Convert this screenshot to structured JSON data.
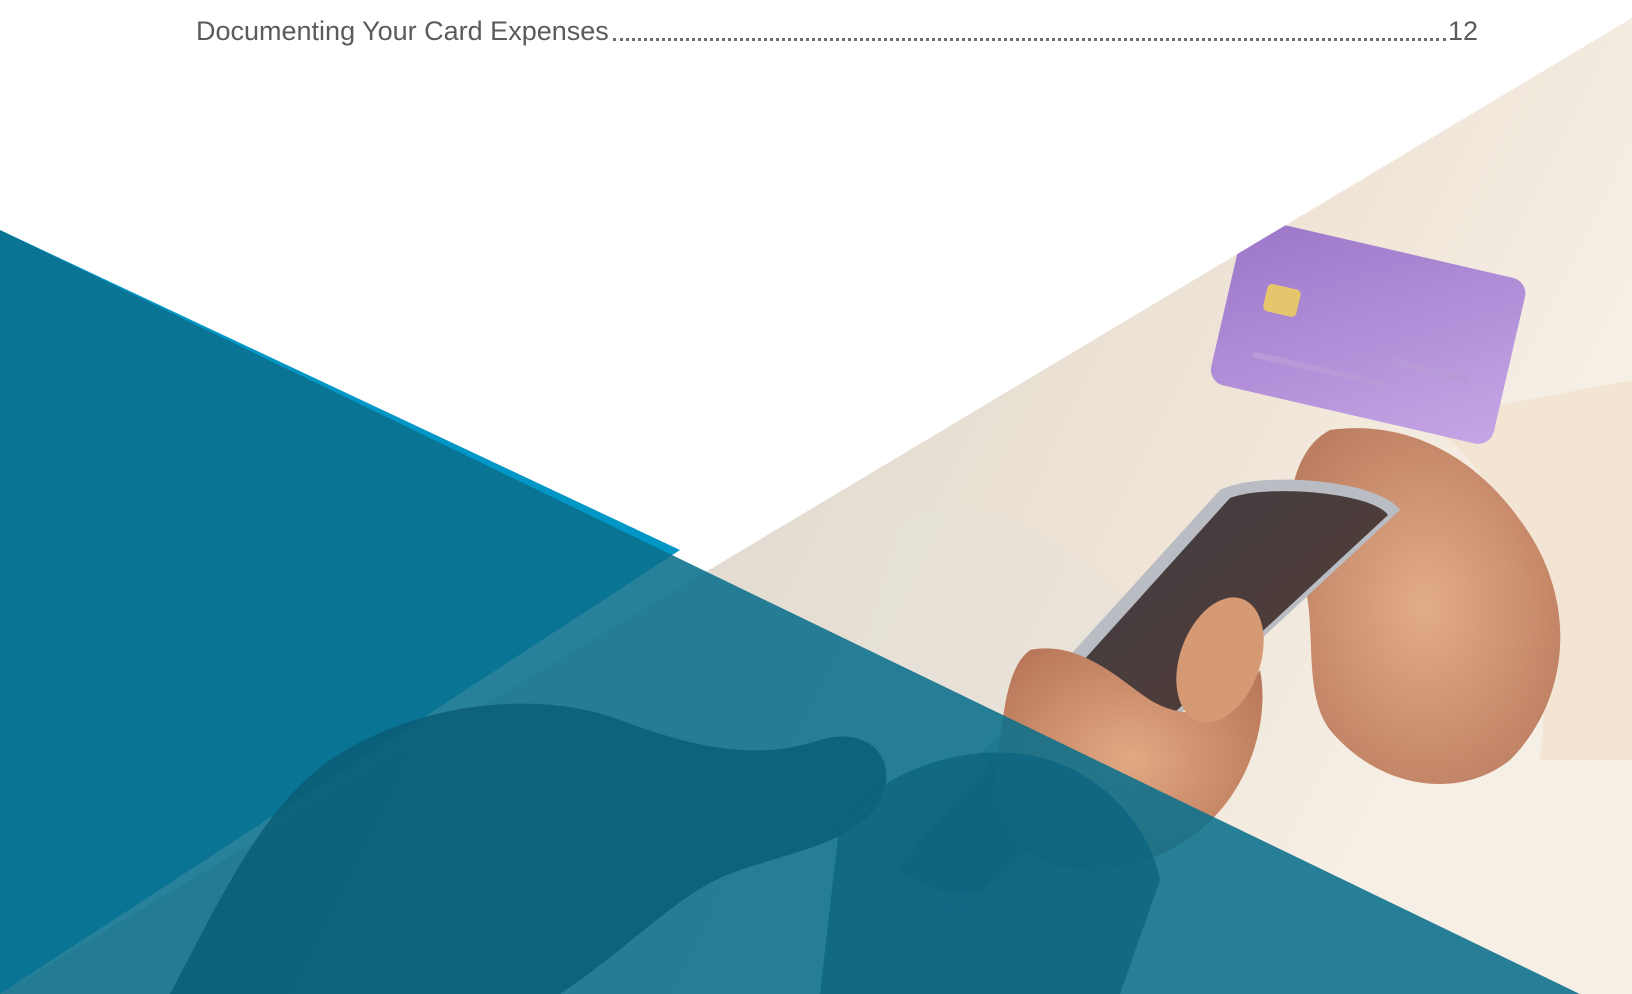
{
  "toc": {
    "entries": [
      {
        "title": "Documenting Your Card Expenses",
        "page": "12"
      }
    ]
  },
  "colors": {
    "background": "#ffffff",
    "accent_blue": "#0096c6",
    "overlay_teal": "#0a6f8c",
    "text_gray": "#5b5b5b"
  },
  "icons": {
    "photo": "hands-with-phone-and-credit-card-photo"
  }
}
